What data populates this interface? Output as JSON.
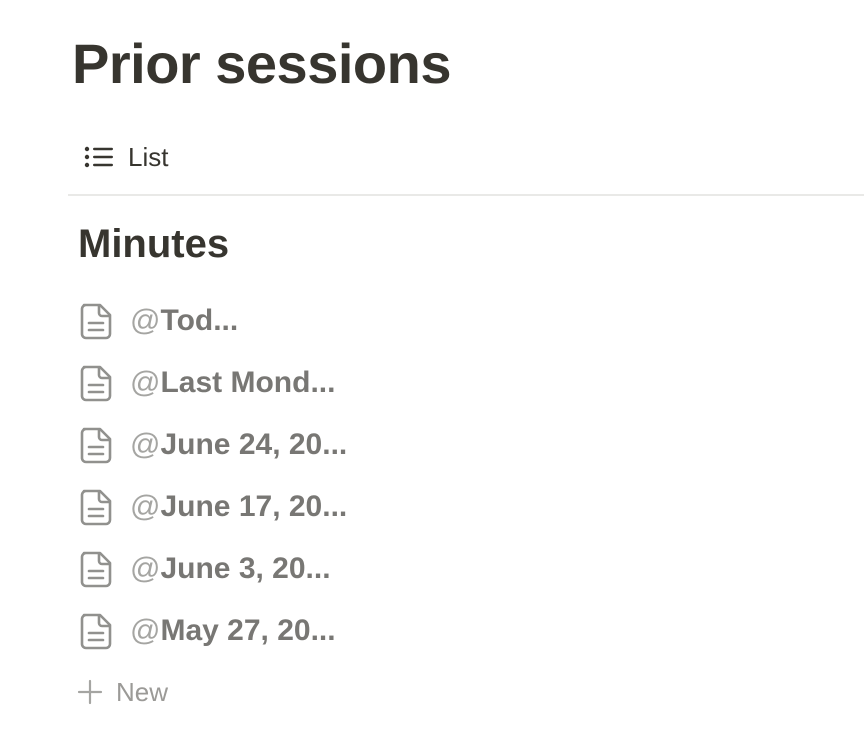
{
  "page": {
    "title": "Prior sessions"
  },
  "views": {
    "active": {
      "icon": "list-icon",
      "label": "List"
    }
  },
  "group": {
    "title": "Minutes"
  },
  "items": [
    {
      "icon": "document-icon",
      "prefix": "@",
      "title": "Tod..."
    },
    {
      "icon": "document-icon",
      "prefix": "@",
      "title": "Last Mond..."
    },
    {
      "icon": "document-icon",
      "prefix": "@",
      "title": "June 24, 20..."
    },
    {
      "icon": "document-icon",
      "prefix": "@",
      "title": "June 17, 20..."
    },
    {
      "icon": "document-icon",
      "prefix": "@",
      "title": "June 3, 20..."
    },
    {
      "icon": "document-icon",
      "prefix": "@",
      "title": "May 27, 20..."
    }
  ],
  "new_item": {
    "icon": "plus-icon",
    "label": "New"
  },
  "colors": {
    "text": "#37352f",
    "muted_text": "#787774",
    "faint_text": "#a5a5a2",
    "divider": "#e9e9e7",
    "background": "#ffffff"
  }
}
